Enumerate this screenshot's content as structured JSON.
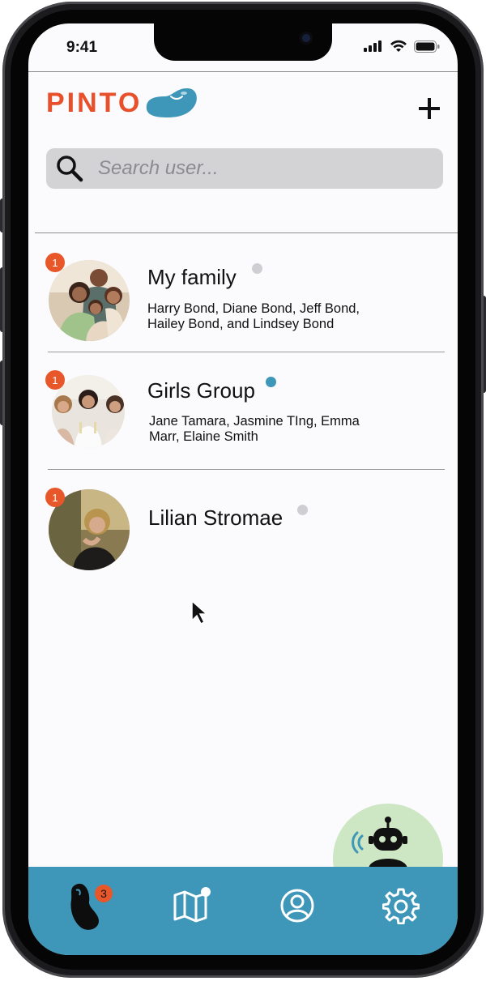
{
  "status_bar": {
    "time": "9:41"
  },
  "header": {
    "logo_text": "PINTO",
    "logo_colors": [
      "#e8502b",
      "#111111",
      "#3e97b8"
    ]
  },
  "search": {
    "placeholder": "Search user..."
  },
  "chats": [
    {
      "name": "My family",
      "members": "Harry Bond, Diane Bond, Jeff Bond, Hailey Bond, and Lindsey Bond",
      "unread": "1",
      "status_color": "#cfcfd3"
    },
    {
      "name": "Girls Group",
      "members": "Jane Tamara, Jasmine TIng, Emma Marr, Elaine Smith",
      "unread": "1",
      "status_color": "#3e97b8"
    },
    {
      "name": "Lilian Stromae",
      "members": "",
      "unread": "1",
      "status_color": "#cfcfd3"
    }
  ],
  "tabbar": {
    "chats_badge": "3",
    "tabs": [
      "chats-bean-icon",
      "map-icon",
      "profile-icon",
      "settings-gear-icon"
    ],
    "color": "#3e97b8"
  },
  "fab": {
    "icon": "robot-assistant-icon",
    "color": "#cde6c3"
  }
}
